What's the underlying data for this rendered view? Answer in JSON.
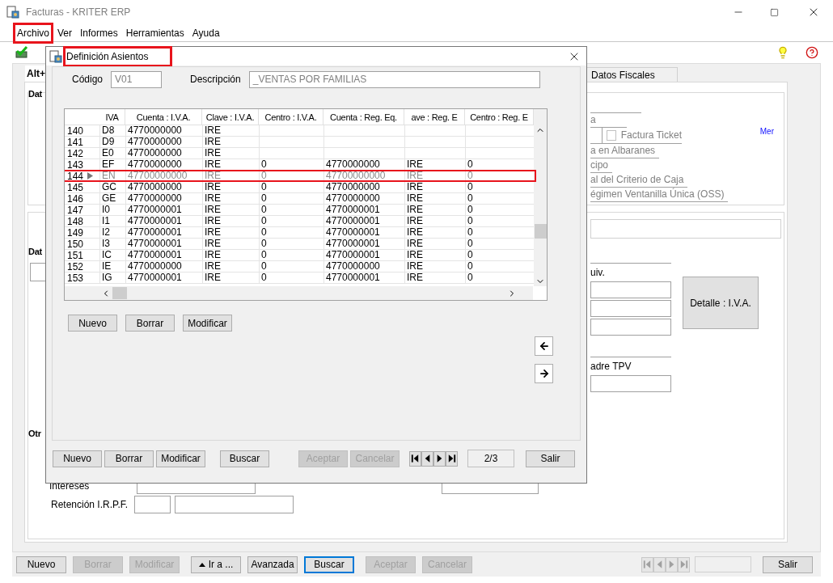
{
  "window": {
    "title": "Facturas - KRITER ERP"
  },
  "menu": [
    {
      "label": "Archivo",
      "highlighted": true
    },
    {
      "label": "Ver",
      "highlighted": false
    },
    {
      "label": "Informes",
      "highlighted": false
    },
    {
      "label": "Herramientas",
      "highlighted": false
    },
    {
      "label": "Ayuda",
      "highlighted": false
    }
  ],
  "form": {
    "tabs": [
      {
        "label": "Alt+",
        "selected": true
      },
      {
        "label": "Datos Fiscales",
        "selected": false
      }
    ],
    "group_1_label": "Dat",
    "group_1_line_1": "a",
    "factura_ticket": {
      "label": "Factura Ticket",
      "checked": false
    },
    "group_1_lines": [
      "a en Albaranes",
      "cipo",
      "al del Criterio de Caja",
      "égimen Ventanilla Única (OSS)"
    ],
    "link": "Mer",
    "group_2_label": "Dat",
    "equiv_label": "uiv.",
    "detalle_button": "Detalle : I.V.A.",
    "tpv_label": "adre TPV",
    "group_3_label": "Otr",
    "intereses_label": "Intereses",
    "retencion_label": "Retención I.R.P.F."
  },
  "bottom_bar": {
    "buttons": [
      {
        "label": "Nuevo",
        "disabled": false,
        "focused": false,
        "kind": "plain"
      },
      {
        "label": "Borrar",
        "disabled": true,
        "focused": false,
        "kind": "plain"
      },
      {
        "label": "Modificar",
        "disabled": true,
        "focused": false,
        "kind": "plain"
      },
      {
        "label": "Ir a ...",
        "disabled": false,
        "focused": false,
        "kind": "dropdown"
      },
      {
        "label": "Avanzada",
        "disabled": false,
        "focused": false,
        "kind": "plain"
      },
      {
        "label": "Buscar",
        "disabled": false,
        "focused": true,
        "kind": "plain"
      },
      {
        "label": "Aceptar",
        "disabled": true,
        "focused": false,
        "kind": "plain"
      },
      {
        "label": "Cancelar",
        "disabled": true,
        "focused": false,
        "kind": "plain"
      }
    ],
    "navigation_disabled": true,
    "exit_button": "Salir"
  },
  "dialog": {
    "title": "Definición Asientos",
    "highlighted": true,
    "codigo_label": "Código",
    "codigo": "V01",
    "descripcion_label": "Descripción",
    "descripcion": "_VENTAS POR FAMILIAS",
    "grid": {
      "columns": [
        "IVA",
        "Cuenta : I.V.A.",
        "Clave : I.V.A.",
        "Centro : I.V.A.",
        "Cuenta : Reg. Eq.",
        "ave : Reg. E",
        "Centro : Reg. E"
      ],
      "rows": [
        {
          "number": "140",
          "cells": [
            "D8",
            "4770000000",
            "IRE",
            "",
            "",
            "",
            ""
          ],
          "selected": false,
          "highlighted": false
        },
        {
          "number": "141",
          "cells": [
            "D9",
            "4770000000",
            "IRE",
            "",
            "",
            "",
            ""
          ],
          "selected": false,
          "highlighted": false
        },
        {
          "number": "142",
          "cells": [
            "E0",
            "4770000000",
            "IRE",
            "",
            "",
            "",
            ""
          ],
          "selected": false,
          "highlighted": false
        },
        {
          "number": "143",
          "cells": [
            "EF",
            "4770000000",
            "IRE",
            "0",
            "4770000000",
            "IRE",
            "0"
          ],
          "selected": false,
          "highlighted": false
        },
        {
          "number": "144",
          "cells": [
            "EN",
            "47700000000",
            "IRE",
            "0",
            "47700000000",
            "IRE",
            "0"
          ],
          "selected": true,
          "highlighted": true
        },
        {
          "number": "145",
          "cells": [
            "GC",
            "4770000000",
            "IRE",
            "0",
            "4770000000",
            "IRE",
            "0"
          ],
          "selected": false,
          "highlighted": false
        },
        {
          "number": "146",
          "cells": [
            "GE",
            "4770000000",
            "IRE",
            "0",
            "4770000000",
            "IRE",
            "0"
          ],
          "selected": false,
          "highlighted": false
        },
        {
          "number": "147",
          "cells": [
            "I0",
            "4770000001",
            "IRE",
            "0",
            "4770000001",
            "IRE",
            "0"
          ],
          "selected": false,
          "highlighted": false
        },
        {
          "number": "148",
          "cells": [
            "I1",
            "4770000001",
            "IRE",
            "0",
            "4770000001",
            "IRE",
            "0"
          ],
          "selected": false,
          "highlighted": false
        },
        {
          "number": "149",
          "cells": [
            "I2",
            "4770000001",
            "IRE",
            "0",
            "4770000001",
            "IRE",
            "0"
          ],
          "selected": false,
          "highlighted": false
        },
        {
          "number": "150",
          "cells": [
            "I3",
            "4770000001",
            "IRE",
            "0",
            "4770000001",
            "IRE",
            "0"
          ],
          "selected": false,
          "highlighted": false
        },
        {
          "number": "151",
          "cells": [
            "IC",
            "4770000001",
            "IRE",
            "0",
            "4770000001",
            "IRE",
            "0"
          ],
          "selected": false,
          "highlighted": false
        },
        {
          "number": "152",
          "cells": [
            "IE",
            "4770000000",
            "IRE",
            "0",
            "4770000000",
            "IRE",
            "0"
          ],
          "selected": false,
          "highlighted": false
        },
        {
          "number": "153",
          "cells": [
            "IG",
            "4770000001",
            "IRE",
            "0",
            "4770000001",
            "IRE",
            "0"
          ],
          "selected": false,
          "highlighted": false
        }
      ]
    },
    "grid_buttons": [
      "Nuevo",
      "Borrar",
      "Modificar"
    ],
    "footer_buttons": [
      {
        "label": "Nuevo",
        "disabled": false
      },
      {
        "label": "Borrar",
        "disabled": false
      },
      {
        "label": "Modificar",
        "disabled": false
      },
      {
        "label": "Buscar",
        "disabled": false
      },
      {
        "label": "Aceptar",
        "disabled": true
      },
      {
        "label": "Cancelar",
        "disabled": true
      }
    ],
    "record": "2/3",
    "exit_button": "Salir"
  }
}
